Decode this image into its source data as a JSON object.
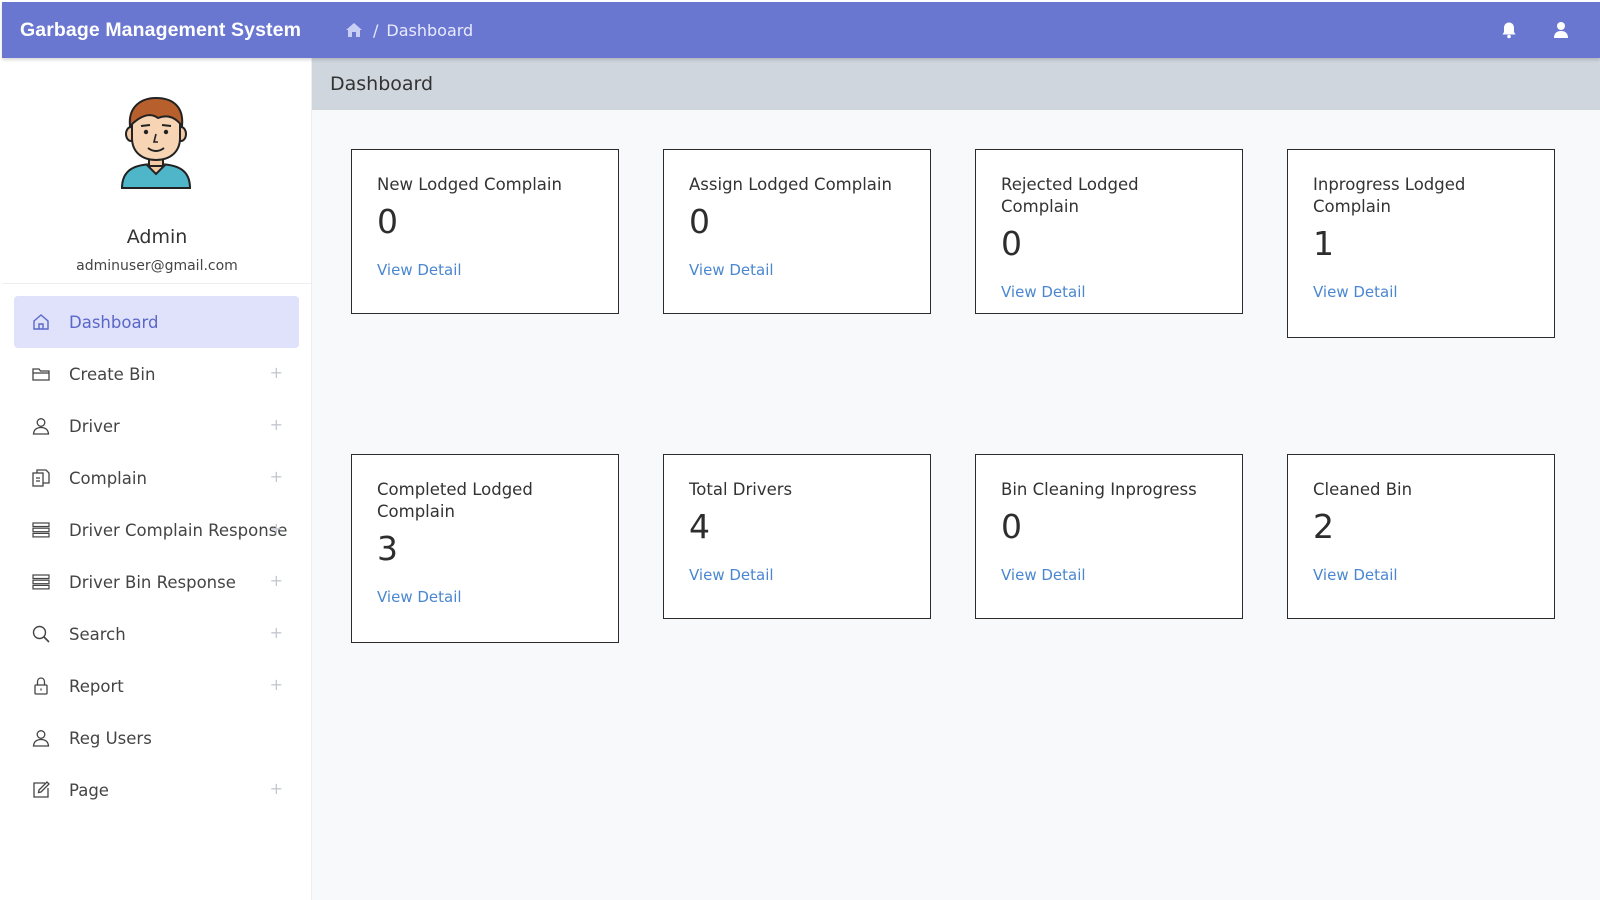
{
  "app": {
    "title": "Garbage Management System"
  },
  "breadcrumb": {
    "current": "Dashboard",
    "separator": "/"
  },
  "profile": {
    "name": "Admin",
    "email": "adminuser@gmail.com"
  },
  "sidebar": {
    "items": [
      {
        "label": "Dashboard",
        "icon": "home-icon",
        "expandable": false,
        "active": true
      },
      {
        "label": "Create Bin",
        "icon": "folder-icon",
        "expandable": true
      },
      {
        "label": "Driver",
        "icon": "user-icon",
        "expandable": true
      },
      {
        "label": "Complain",
        "icon": "documents-icon",
        "expandable": true
      },
      {
        "label": "Driver Complain Response",
        "icon": "list-icon",
        "expandable": true
      },
      {
        "label": "Driver Bin Response",
        "icon": "list-icon",
        "expandable": true
      },
      {
        "label": "Search",
        "icon": "search-icon",
        "expandable": true
      },
      {
        "label": "Report",
        "icon": "lock-icon",
        "expandable": true
      },
      {
        "label": "Reg Users",
        "icon": "user-icon",
        "expandable": false
      },
      {
        "label": "Page",
        "icon": "edit-icon",
        "expandable": true
      }
    ],
    "plus_glyph": "+"
  },
  "page": {
    "title": "Dashboard"
  },
  "cards": [
    {
      "title": "New Lodged Complain",
      "value": "0",
      "link": "View Detail"
    },
    {
      "title": "Assign Lodged Complain",
      "value": "0",
      "link": "View Detail"
    },
    {
      "title": "Rejected Lodged Complain",
      "value": "0",
      "link": "View Detail"
    },
    {
      "title": "Inprogress Lodged Complain",
      "value": "1",
      "link": "View Detail"
    },
    {
      "title": "Completed Lodged Complain",
      "value": "3",
      "link": "View Detail"
    },
    {
      "title": "Total Drivers",
      "value": "4",
      "link": "View Detail"
    },
    {
      "title": "Bin Cleaning Inprogress",
      "value": "0",
      "link": "View Detail"
    },
    {
      "title": "Cleaned Bin",
      "value": "2",
      "link": "View Detail"
    }
  ],
  "colors": {
    "topbar": "#6a77d0",
    "active_bg": "#dfe2fa",
    "active_text": "#5a67c8",
    "link": "#4a87d0",
    "header_bar": "#d0d6de"
  }
}
